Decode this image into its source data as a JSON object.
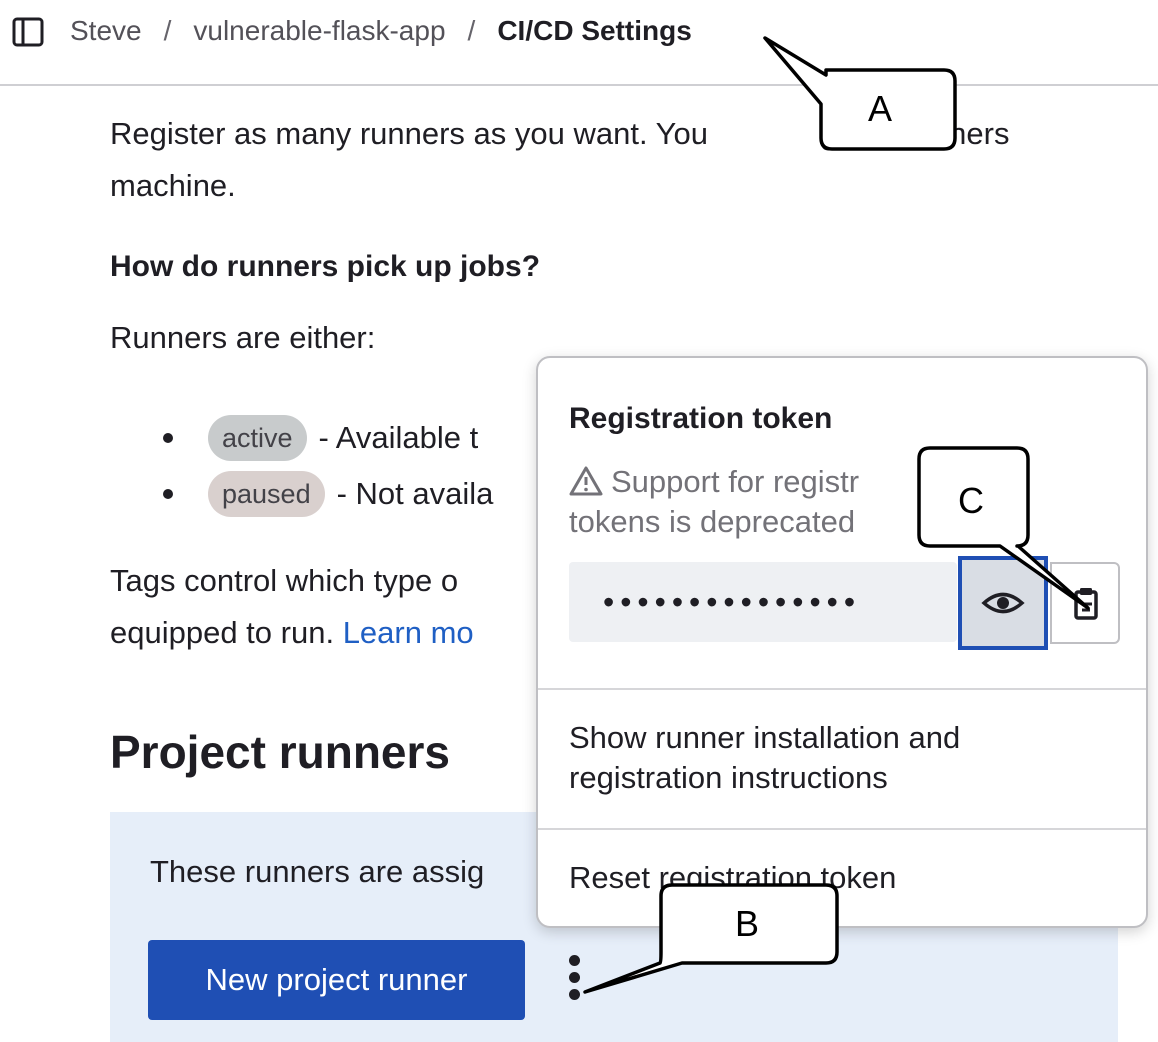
{
  "breadcrumb": {
    "items": [
      "Steve",
      "vulnerable-flask-app"
    ],
    "current": "CI/CD Settings"
  },
  "content": {
    "intro": "Register as many runners as you want. You can register runners as separate users, on separate servers, and on your local machine.",
    "intro_visible_line1": "Register as many runners as you want. You",
    "intro_visible_line1_tail": "gister runners",
    "intro_visible_line2": "machine.",
    "jobs_heading": "How do runners pick up jobs?",
    "runners_either": "Runners are either:",
    "bullets": [
      {
        "badge": "active",
        "text": "- Available t"
      },
      {
        "badge": "paused",
        "text": "- Not availa"
      }
    ],
    "tags_line1": "Tags control which type o",
    "tags_line2_prefix": "equipped to run. ",
    "learn_more": "Learn mo",
    "project_runners_heading": "Project runners",
    "assigned_text": "These runners are assig",
    "new_runner_button": "New project runner"
  },
  "popover": {
    "title": "Registration token",
    "warning_line1": "Support for registr",
    "warning_line2": "tokens is deprecated",
    "token_mask": "•••••••••••••••",
    "show_instructions": "Show runner installation and registration instructions",
    "reset_token": "Reset registration token"
  },
  "callouts": {
    "a": "A",
    "b": "B",
    "c": "C"
  },
  "colors": {
    "primary": "#1f4fb4",
    "link": "#1f5fc4",
    "panel_bg": "#e6eef9",
    "badge_active": "#c8cbcc",
    "badge_paused": "#d9d0ce"
  },
  "icons": [
    "sidebar-toggle-icon",
    "warning-icon",
    "eye-icon",
    "copy-icon",
    "kebab-icon"
  ]
}
